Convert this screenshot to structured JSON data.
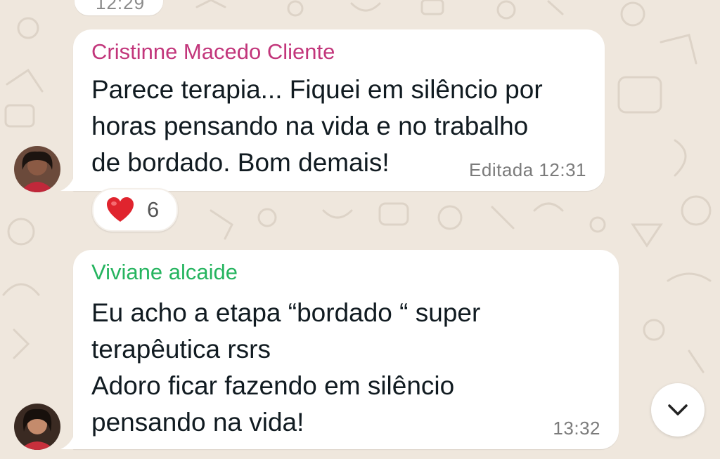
{
  "chat": {
    "previous_time": "12:29",
    "messages": [
      {
        "sender": "Cristinne Macedo Cliente",
        "lines": [
          "Parece terapia... Fiquei em silêncio por",
          "horas pensando na vida e no trabalho",
          "de bordado. Bom demais!"
        ],
        "meta": "Editada 12:31",
        "reaction": {
          "emoji": "heart-icon",
          "count": "6"
        }
      },
      {
        "sender": "Viviane alcaide",
        "lines": [
          "Eu acho a etapa “bordado “ super",
          "terapêutica rsrs",
          "Adoro ficar fazendo em silêncio",
          "pensando na vida!"
        ],
        "meta": "13:32"
      }
    ]
  },
  "colors": {
    "background": "#efe7dd",
    "sender1": "#c2367b",
    "sender2": "#25b45f",
    "bubble": "#ffffff"
  },
  "scroll_button": {
    "icon": "chevron-down-icon"
  }
}
